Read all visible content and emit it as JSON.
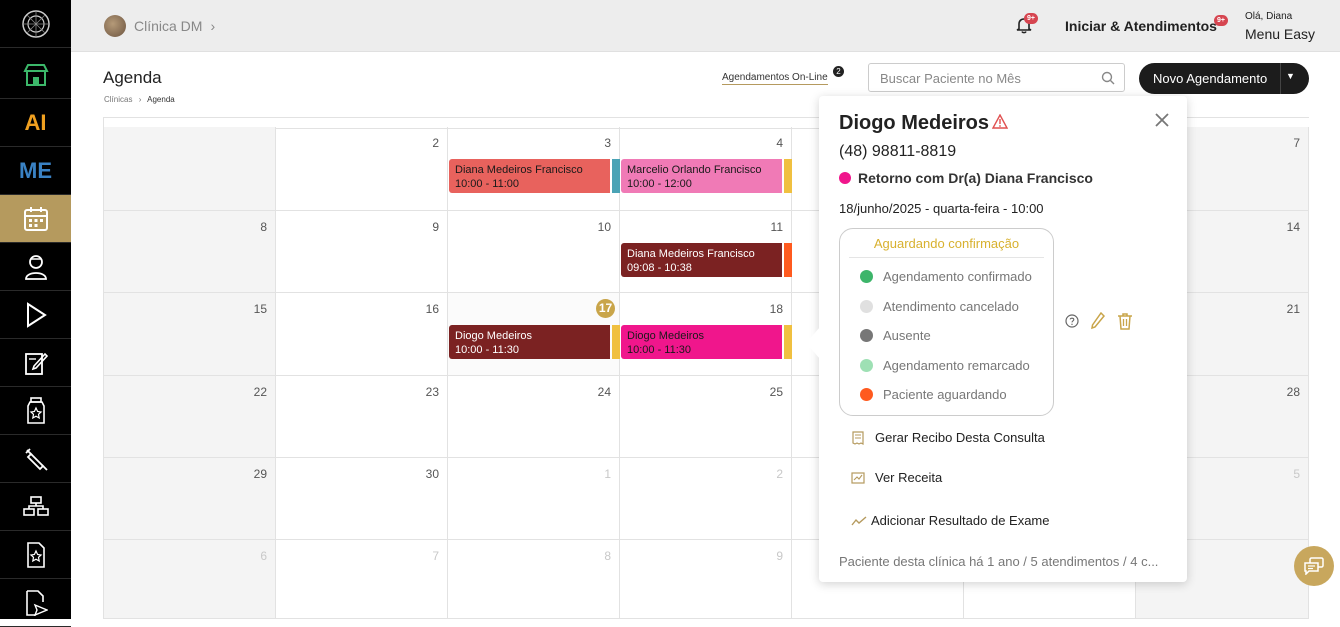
{
  "sidebar": {
    "items": [
      {
        "icon": "logo-icon"
      },
      {
        "icon": "store-icon"
      },
      {
        "icon": "ai-icon",
        "text": "AI"
      },
      {
        "icon": "me-icon",
        "text": "ME"
      },
      {
        "icon": "calendar-icon"
      },
      {
        "icon": "doctor-icon"
      },
      {
        "icon": "play-icon"
      },
      {
        "icon": "edit-note-icon"
      },
      {
        "icon": "medicine-icon"
      },
      {
        "icon": "syringe-icon"
      },
      {
        "icon": "hierarchy-icon"
      },
      {
        "icon": "star-doc-icon"
      },
      {
        "icon": "send-doc-icon"
      }
    ]
  },
  "topbar": {
    "clinic": "Clínica DM",
    "notif_badge": "9+",
    "iniciar": "Iniciar & Atendimentos",
    "iniciar_badge": "9+",
    "greeting": "Olá, Diana",
    "menu": "Menu Easy"
  },
  "header": {
    "title": "Agenda",
    "breadcrumb_1": "Clínicas",
    "breadcrumb_2": "Agenda",
    "online_label": "Agendamentos On-Line",
    "online_count": "2",
    "search_placeholder": "Buscar Paciente no Mês",
    "new_label": "Novo Agendamento"
  },
  "calendar": {
    "weeks": [
      [
        "",
        "2",
        "3",
        "4",
        "",
        "",
        "7"
      ],
      [
        "8",
        "9",
        "10",
        "11",
        "",
        "",
        "14"
      ],
      [
        "15",
        "16",
        "17",
        "18",
        "",
        "",
        "21"
      ],
      [
        "22",
        "23",
        "24",
        "25",
        "",
        "",
        "28"
      ],
      [
        "29",
        "30",
        "1",
        "2",
        "",
        "",
        "5"
      ],
      [
        "6",
        "7",
        "8",
        "9",
        "",
        "",
        ""
      ]
    ],
    "first_day": "1",
    "events": [
      {
        "name": "Diana Medeiros Francisco",
        "time": "10:00 - 11:00",
        "color": "#e8625d",
        "strip": "#4aa3b5"
      },
      {
        "name": "Marcelio Orlando Francisco",
        "time": "10:00 - 12:00",
        "color": "#f07ab6",
        "strip": "#f0c040"
      },
      {
        "name": "Diana Medeiros Francisco",
        "time": "09:08 - 10:38",
        "color": "#7b2222",
        "strip": "#ff5a1f"
      },
      {
        "name": "Diogo Medeiros",
        "time": "10:00 - 11:30",
        "color": "#7b2222",
        "strip": "#f0c040"
      },
      {
        "name": "Diogo Medeiros",
        "time": "10:00 - 11:30",
        "color": "#f0168c",
        "strip": "#f0c040"
      }
    ]
  },
  "popover": {
    "name": "Diogo Medeiros",
    "phone": "(48) 98811-8819",
    "retorno": "Retorno com Dr(a) Diana Francisco",
    "retorno_color": "#f0168c",
    "date": "18/junho/2025 - quarta-feira - 10:00",
    "status_title": "Aguardando confirmação",
    "status_options": [
      {
        "label": "Agendamento confirmado",
        "color": "#3db56a"
      },
      {
        "label": "Atendimento cancelado",
        "color": "#e0e0e0"
      },
      {
        "label": "Ausente",
        "color": "#777777"
      },
      {
        "label": "Agendamento remarcado",
        "color": "#9ee0b4"
      },
      {
        "label": "Paciente aguardando",
        "color": "#ff5a1f"
      }
    ],
    "links": [
      "Gerar Recibo Desta Consulta",
      "Ver Receita",
      "Adicionar Resultado de Exame"
    ],
    "footer": "Paciente desta clínica há 1 ano / 5 atendimentos / 4 c..."
  }
}
